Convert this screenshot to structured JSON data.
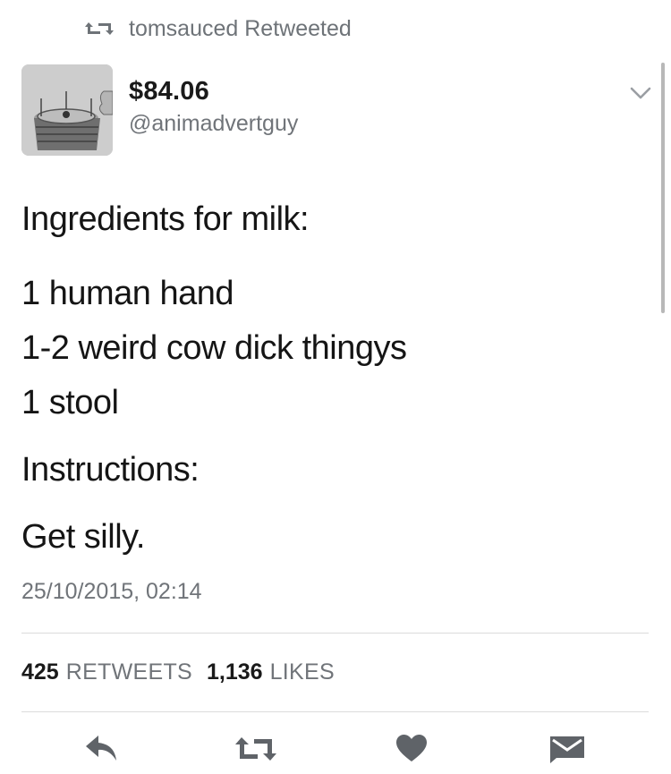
{
  "retweet_context": {
    "text": "tomsauced Retweeted",
    "icon": "retweet-icon"
  },
  "author": {
    "display_name": "$84.06",
    "handle": "@animadvertguy",
    "avatar": "avatar-drawing"
  },
  "tweet": {
    "heading": "Ingredients for milk:",
    "ingredients": [
      "1 human hand",
      "1-2 weird cow dick thingys",
      "1 stool"
    ],
    "instructions_heading": "Instructions:",
    "instructions": "Get silly.",
    "timestamp": "25/10/2015, 02:14"
  },
  "stats": {
    "retweets_count": "425",
    "retweets_label": "RETWEETS",
    "likes_count": "1,136",
    "likes_label": "LIKES"
  },
  "actions": [
    "reply-icon",
    "retweet-icon",
    "heart-icon",
    "direct-message-icon"
  ],
  "colors": {
    "text": "#1a1a1a",
    "secondary": "#707479",
    "icon": "#5f6368",
    "divider": "#dcdcdc"
  }
}
